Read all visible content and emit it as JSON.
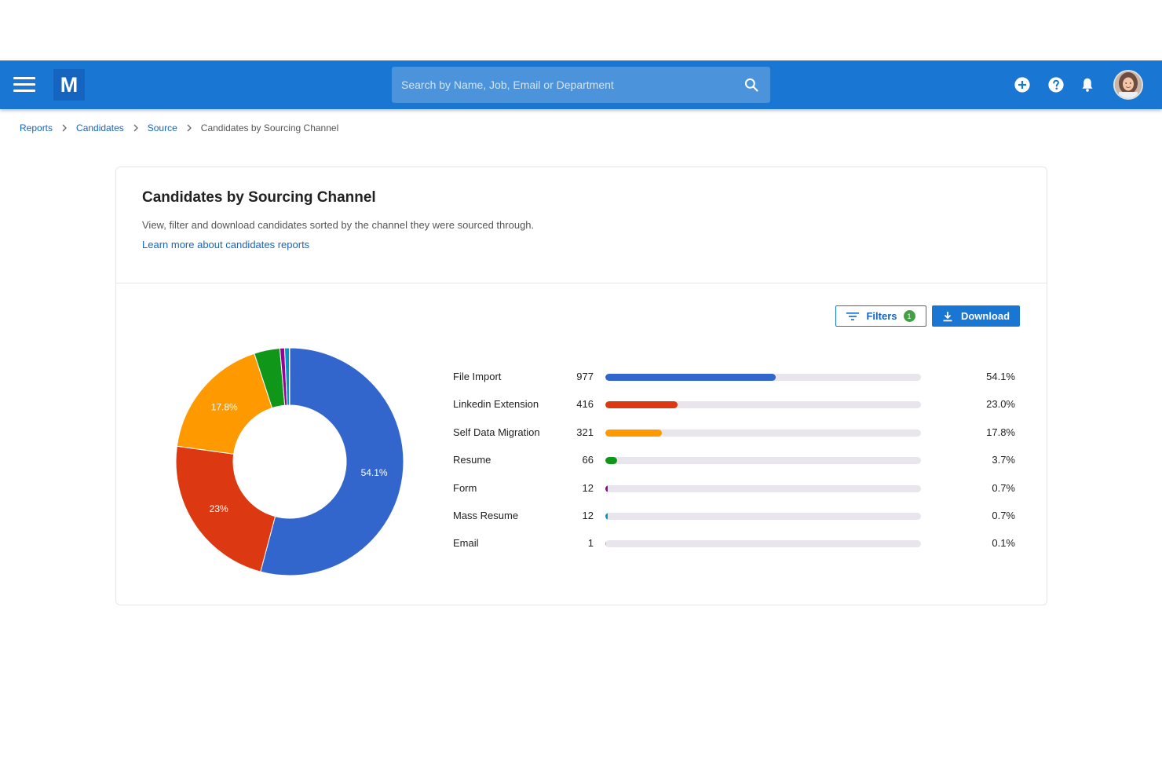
{
  "header": {
    "logo_letter": "M",
    "search_placeholder": "Search by Name, Job, Email or Department"
  },
  "breadcrumb": {
    "items": [
      "Reports",
      "Candidates",
      "Source"
    ],
    "current": "Candidates by Sourcing Channel"
  },
  "card": {
    "title": "Candidates by Sourcing Channel",
    "description": "View, filter and download candidates sorted by the channel they were sourced through.",
    "learn_more": "Learn more about candidates reports",
    "filters_label": "Filters",
    "filters_count": "1",
    "download_label": "Download"
  },
  "colors": {
    "primary": "#1976d2",
    "file_import": "#3366cc",
    "linkedin": "#dc3912",
    "self_data": "#ff9900",
    "resume": "#109618",
    "form": "#990099",
    "mass_resume": "#0099c6",
    "email": "#aaaaaa"
  },
  "chart_data": {
    "type": "pie",
    "categories": [
      "File Import",
      "Linkedin Extension",
      "Self Data Migration",
      "Resume",
      "Form",
      "Mass Resume",
      "Email"
    ],
    "values": [
      977,
      416,
      321,
      66,
      12,
      12,
      1
    ],
    "percent_labels": [
      "54.1%",
      "23.0%",
      "17.8%",
      "3.7%",
      "0.7%",
      "0.7%",
      "0.1%"
    ],
    "slice_labels": [
      "54.1%",
      "23%",
      "17.8%",
      "",
      "",
      "",
      ""
    ],
    "percents": [
      54.1,
      23.0,
      17.8,
      3.7,
      0.7,
      0.7,
      0.1
    ],
    "colors": [
      "#3366cc",
      "#dc3912",
      "#ff9900",
      "#109618",
      "#990099",
      "#0099c6",
      "#aaaaaa"
    ]
  }
}
